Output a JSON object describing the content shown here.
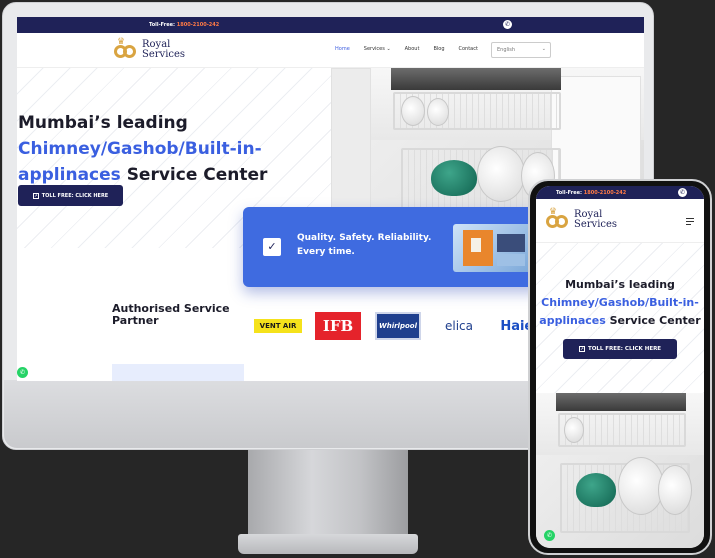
{
  "topbar": {
    "toll_free_label": "Toll-Free:",
    "toll_free_number": "1800-2100-242"
  },
  "logo": {
    "line1": "Royal",
    "line2": "Services"
  },
  "nav": {
    "items": [
      {
        "label": "Home"
      },
      {
        "label": "Services ⌄"
      },
      {
        "label": "About"
      },
      {
        "label": "Blog"
      },
      {
        "label": "Contact"
      }
    ],
    "language": "English"
  },
  "hero": {
    "line1": "Mumbai’s leading",
    "highlight": "Chimney/Gashob/Built-in-applinaces",
    "line3": "Service Center",
    "cta_label": "TOLL FREE: CLICK HERE"
  },
  "quality": {
    "text": "Quality. Safety. Reliability. Every time."
  },
  "partners": {
    "title": "Authorised Service Partner",
    "brands": [
      "VENT AIR",
      "IFB",
      "Whirlpool",
      "elica",
      "Haier"
    ]
  },
  "mobile": {
    "toll_free_label": "Toll-Free:",
    "toll_free_number": "1800-2100-242",
    "line1": "Mumbai’s leading",
    "highlight": "Chimney/Gashob/Built-in-applinaces",
    "line3": "Service Center",
    "cta_label": "TOLL FREE: CLICK HERE"
  },
  "colors": {
    "navy": "#1f2258",
    "accent_blue": "#3f6be0",
    "accent_orange": "#ff7a45",
    "whatsapp": "#25d366"
  },
  "icons": [
    "phone-icon",
    "check-icon",
    "whatsapp-icon",
    "menu-icon",
    "chevron-down-icon",
    "external-link-icon"
  ]
}
